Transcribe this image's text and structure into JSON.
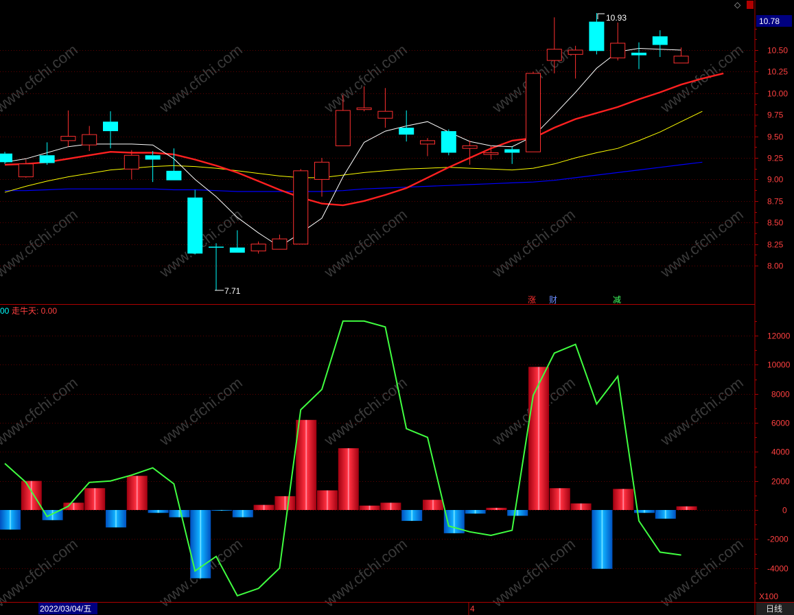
{
  "header": {
    "diamond_icon": "diamond-icon",
    "scroll_icon": "scroll-icon",
    "current_price": "10.78"
  },
  "main_chart": {
    "yticks": [
      "10.50",
      "10.25",
      "10.00",
      "9.75",
      "9.50",
      "9.25",
      "9.00",
      "8.75",
      "8.50",
      "8.25",
      "8.00"
    ],
    "high_label": "10.93",
    "low_label": "7.71",
    "markers": [
      {
        "text": "涨",
        "color": "#ff3030"
      },
      {
        "text": "财",
        "color": "#6a8cff"
      },
      {
        "text": "减",
        "color": "#40ff60"
      }
    ]
  },
  "sub_chart": {
    "legend_left": "00",
    "legend_text": "走牛天: 0.00",
    "yticks": [
      "12000",
      "10000",
      "8000",
      "6000",
      "4000",
      "2000",
      "0",
      "-2000",
      "-4000"
    ]
  },
  "bottom_bar": {
    "date": "2022/03/04/五",
    "marker": "4",
    "scale": "X100",
    "period": "日线"
  },
  "watermark": "www.cfchi.com",
  "colors": {
    "up": "#ff3030",
    "down": "#00ffff",
    "ma5": "#ffffff",
    "ma10": "#ff2020",
    "ma20": "#ffff00",
    "ma60": "#0000ff",
    "line": "#40ff40",
    "axis": "#b00000",
    "text": "#ff4040"
  },
  "chart_data": [
    {
      "type": "candlestick",
      "ylim": [
        7.5,
        11.0
      ],
      "candles": [
        {
          "o": 9.3,
          "c": 9.2,
          "h": 9.32,
          "l": 9.18
        },
        {
          "o": 9.03,
          "c": 9.18,
          "h": 9.23,
          "l": 9.02
        },
        {
          "o": 9.28,
          "c": 9.19,
          "h": 9.43,
          "l": 9.17
        },
        {
          "o": 9.45,
          "c": 9.5,
          "h": 9.8,
          "l": 9.38
        },
        {
          "o": 9.4,
          "c": 9.52,
          "h": 9.62,
          "l": 9.33
        },
        {
          "o": 9.67,
          "c": 9.56,
          "h": 9.79,
          "l": 9.36
        },
        {
          "o": 9.12,
          "c": 9.28,
          "h": 9.34,
          "l": 9.0
        },
        {
          "o": 9.28,
          "c": 9.23,
          "h": 9.33,
          "l": 8.97
        },
        {
          "o": 9.1,
          "c": 8.99,
          "h": 9.36,
          "l": 8.99
        },
        {
          "o": 8.79,
          "c": 8.14,
          "h": 8.88,
          "l": 8.13
        },
        {
          "o": 8.22,
          "c": 8.21,
          "h": 8.26,
          "l": 7.71
        },
        {
          "o": 8.21,
          "c": 8.15,
          "h": 8.41,
          "l": 8.15
        },
        {
          "o": 8.17,
          "c": 8.25,
          "h": 8.28,
          "l": 8.14
        },
        {
          "o": 8.19,
          "c": 8.31,
          "h": 8.36,
          "l": 8.19
        },
        {
          "o": 8.25,
          "c": 9.1,
          "h": 9.12,
          "l": 8.25
        },
        {
          "o": 9.0,
          "c": 9.2,
          "h": 9.25,
          "l": 8.8
        },
        {
          "o": 9.39,
          "c": 9.8,
          "h": 9.98,
          "l": 9.39
        },
        {
          "o": 9.81,
          "c": 9.83,
          "h": 10.08,
          "l": 9.79
        },
        {
          "o": 9.71,
          "c": 9.79,
          "h": 10.06,
          "l": 9.6
        },
        {
          "o": 9.6,
          "c": 9.52,
          "h": 9.8,
          "l": 9.44
        },
        {
          "o": 9.41,
          "c": 9.45,
          "h": 9.48,
          "l": 9.27
        },
        {
          "o": 9.56,
          "c": 9.31,
          "h": 9.58,
          "l": 9.28
        },
        {
          "o": 9.36,
          "c": 9.39,
          "h": 9.45,
          "l": 9.17
        },
        {
          "o": 9.29,
          "c": 9.31,
          "h": 9.39,
          "l": 9.23
        },
        {
          "o": 9.35,
          "c": 9.31,
          "h": 9.38,
          "l": 9.18
        },
        {
          "o": 9.32,
          "c": 10.23,
          "h": 10.25,
          "l": 9.32
        },
        {
          "o": 10.38,
          "c": 10.51,
          "h": 10.88,
          "l": 10.23
        },
        {
          "o": 10.45,
          "c": 10.5,
          "h": 10.55,
          "l": 10.17
        },
        {
          "o": 10.83,
          "c": 10.49,
          "h": 10.93,
          "l": 10.45
        },
        {
          "o": 10.41,
          "c": 10.58,
          "h": 10.82,
          "l": 10.38
        },
        {
          "o": 10.47,
          "c": 10.44,
          "h": 10.59,
          "l": 10.28
        },
        {
          "o": 10.66,
          "c": 10.56,
          "h": 10.73,
          "l": 10.42
        },
        {
          "o": 10.35,
          "c": 10.43,
          "h": 10.53,
          "l": 10.35
        }
      ],
      "ma5": [
        9.2,
        9.24,
        9.31,
        9.38,
        9.41,
        9.41,
        9.41,
        9.4,
        9.24,
        9.0,
        8.8,
        8.56,
        8.38,
        8.22,
        8.38,
        8.55,
        9.03,
        9.43,
        9.56,
        9.62,
        9.67,
        9.55,
        9.44,
        9.39,
        9.38,
        9.5,
        9.75,
        10.01,
        10.29,
        10.48,
        10.52,
        10.51,
        10.5
      ],
      "ma10": [
        9.17,
        9.18,
        9.2,
        9.24,
        9.28,
        9.32,
        9.31,
        9.31,
        9.29,
        9.23,
        9.16,
        9.08,
        8.98,
        8.88,
        8.79,
        8.72,
        8.7,
        8.75,
        8.82,
        8.9,
        9.02,
        9.14,
        9.25,
        9.36,
        9.45,
        9.48,
        9.6,
        9.7,
        9.77,
        9.84,
        9.93,
        10.01,
        10.1,
        10.17,
        10.23
      ],
      "ma20": [
        8.85,
        8.92,
        8.98,
        9.03,
        9.07,
        9.11,
        9.13,
        9.15,
        9.16,
        9.15,
        9.13,
        9.1,
        9.07,
        9.04,
        9.02,
        9.02,
        9.05,
        9.08,
        9.1,
        9.12,
        9.13,
        9.14,
        9.13,
        9.12,
        9.11,
        9.13,
        9.18,
        9.25,
        9.31,
        9.36,
        9.45,
        9.55,
        9.67,
        9.79
      ],
      "ma60": [
        8.87,
        8.87,
        8.88,
        8.89,
        8.89,
        8.89,
        8.89,
        8.89,
        8.88,
        8.88,
        8.87,
        8.86,
        8.86,
        8.86,
        8.86,
        8.86,
        8.87,
        8.89,
        8.9,
        8.91,
        8.92,
        8.93,
        8.94,
        8.95,
        8.96,
        8.97,
        8.99,
        9.02,
        9.05,
        9.08,
        9.11,
        9.14,
        9.17,
        9.2
      ]
    },
    {
      "type": "bar+line",
      "ylim": [
        -6000,
        14000
      ],
      "bars": [
        -1350,
        2000,
        -700,
        500,
        1500,
        -1200,
        2350,
        -200,
        -500,
        -4700,
        -50,
        -500,
        350,
        950,
        6200,
        1350,
        4250,
        300,
        500,
        -750,
        700,
        -1600,
        -250,
        150,
        -400,
        9850,
        1500,
        450,
        -4050,
        1450,
        -200,
        -600,
        250
      ],
      "line": [
        3200,
        1900,
        -450,
        250,
        1900,
        2000,
        2400,
        2900,
        1800,
        -4200,
        -3200,
        -5900,
        -5400,
        -4000,
        6900,
        8300,
        13000,
        13000,
        12600,
        5600,
        5000,
        -1100,
        -1500,
        -1750,
        -1400,
        7900,
        10800,
        11400,
        7300,
        9200,
        -750,
        -2900,
        -3100
      ]
    }
  ]
}
